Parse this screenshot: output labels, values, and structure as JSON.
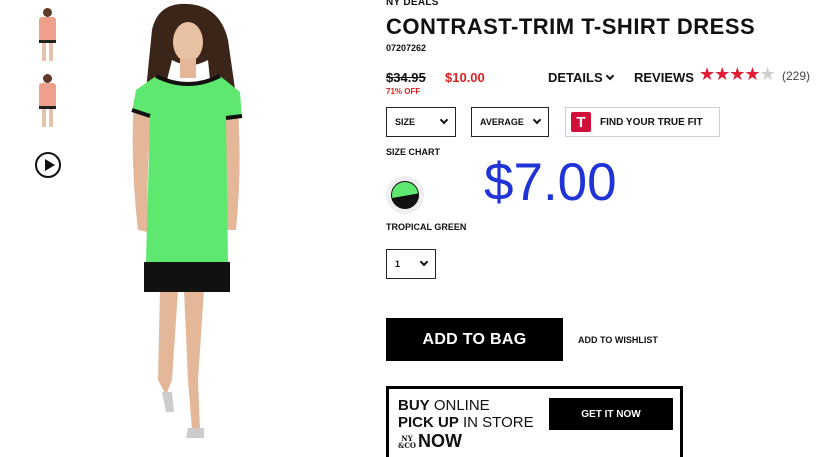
{
  "thumbnails": [
    {
      "label": "front view thumbnail"
    },
    {
      "label": "back view thumbnail"
    }
  ],
  "product": {
    "brand_tag": "NY DEALS",
    "title": "CONTRAST-TRIM T-SHIRT DRESS",
    "sku": "07207262",
    "old_price": "$34.95",
    "new_price": "$10.00",
    "discount": "71% OFF",
    "details_label": "DETAILS",
    "reviews_label": "REVIEWS",
    "rating": 4.5,
    "stars_display": "★★★★",
    "star_half": "★",
    "review_count": "(229)",
    "overlay_price": "$7.00"
  },
  "options": {
    "size_label": "SIZE",
    "fit_label": "AVERAGE",
    "truefit_logo": "T",
    "truefit_label": "FIND YOUR TRUE FIT",
    "size_chart_label": "SIZE CHART",
    "color_name": "TROPICAL GREEN",
    "quantity": "1"
  },
  "actions": {
    "add_to_bag": "ADD TO BAG",
    "wishlist": "ADD TO WISHLIST"
  },
  "bopis": {
    "buy_bold": "BUY",
    "buy_rest": " ONLINE",
    "pickup_bold": "PICK UP",
    "pickup_rest": " IN STORE",
    "logo_top": "NY",
    "logo_bottom": "&CO",
    "now": "NOW",
    "cta": "GET IT NOW"
  },
  "colors": {
    "sale_red": "#e02020",
    "overlay_blue": "#1f33d6",
    "dress_green": "#5ee870",
    "star_red": "#e21c35"
  }
}
